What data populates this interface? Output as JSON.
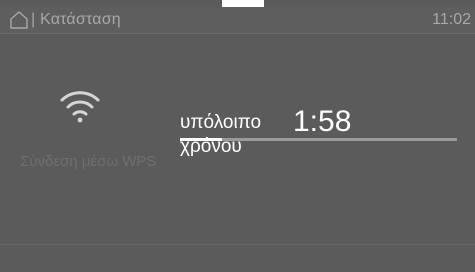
{
  "status_bar": {
    "separator": "|",
    "title": "Κατάσταση",
    "time": "11:02"
  },
  "icons": {
    "home": "home-icon",
    "wifi": "wifi-icon"
  },
  "wps": {
    "label": "Σύνδεση μέσω WPS"
  },
  "remaining": {
    "label": "υπόλοιπο χρόνου",
    "value": "1:58",
    "progress_fraction": 0.15
  },
  "colors": {
    "background": "#5b5b5b",
    "text_primary": "#ffffff",
    "text_dim": "#a8a8a8",
    "text_disabled": "#6f6f6f",
    "progress_track": "#9a9a9a",
    "progress_fill": "#ffffff"
  }
}
